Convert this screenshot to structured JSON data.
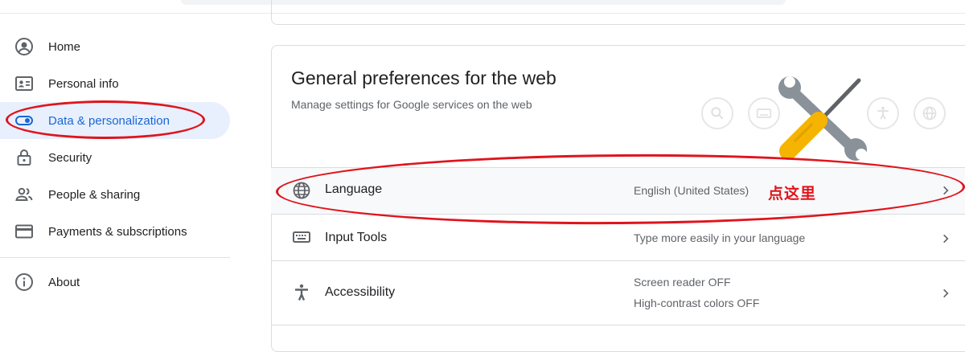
{
  "sidebar": {
    "items": [
      {
        "label": "Home",
        "icon": "account-circle-icon"
      },
      {
        "label": "Personal info",
        "icon": "id-card-icon"
      },
      {
        "label": "Data & personalization",
        "icon": "toggle-icon",
        "active": true
      },
      {
        "label": "Security",
        "icon": "lock-icon"
      },
      {
        "label": "People & sharing",
        "icon": "people-icon"
      },
      {
        "label": "Payments & subscriptions",
        "icon": "credit-card-icon"
      }
    ],
    "about": {
      "label": "About",
      "icon": "info-icon"
    }
  },
  "card": {
    "title": "General preferences for the web",
    "subtitle": "Manage settings for Google services on the web",
    "rows": [
      {
        "name": "Language",
        "value": "English (United States)",
        "icon": "globe-icon"
      },
      {
        "name": "Input Tools",
        "value": "Type more easily in your language",
        "icon": "keyboard-icon"
      },
      {
        "name": "Accessibility",
        "value1": "Screen reader OFF",
        "value2": "High-contrast colors OFF",
        "icon": "accessibility-icon"
      }
    ]
  },
  "annotation": {
    "text": "点这里",
    "color": "#e0141c"
  },
  "colors": {
    "accent": "#1967d2",
    "active_bg": "#e8f0fe",
    "annotation": "#e0141c",
    "tool_yellow": "#f4b400",
    "tool_gray": "#8a9199"
  }
}
